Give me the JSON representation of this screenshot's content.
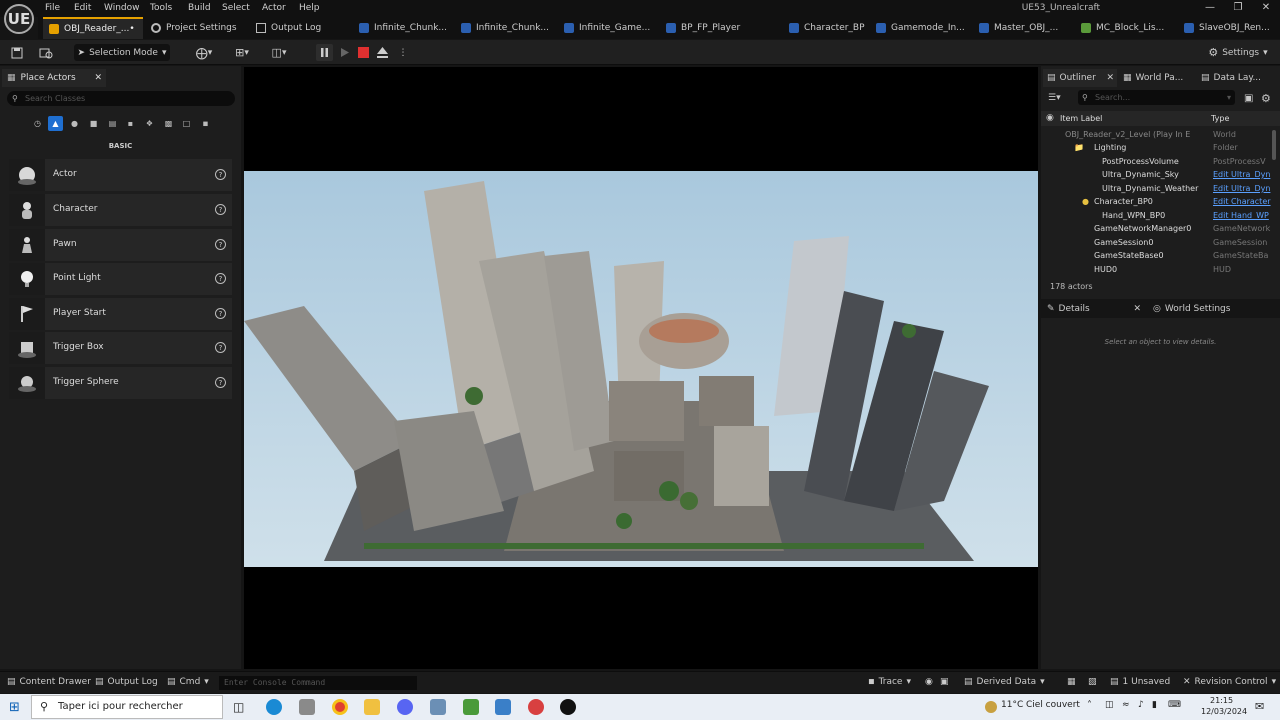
{
  "menu": {
    "items": [
      "File",
      "Edit",
      "Window",
      "Tools",
      "Build",
      "Select",
      "Actor",
      "Help"
    ],
    "logo": "UE",
    "window_title": "UE53_Unrealcraft"
  },
  "tabs": [
    {
      "label": "OBJ_Reader_...•",
      "icon": "level-icon"
    },
    {
      "label": "Project Settings",
      "icon": "settings-icon"
    },
    {
      "label": "Output Log",
      "icon": "document-icon"
    },
    {
      "label": "Infinite_Chunk...",
      "icon": "blueprint-icon"
    },
    {
      "label": "Infinite_Chunk...",
      "icon": "blueprint-icon"
    },
    {
      "label": "Infinite_Game...",
      "icon": "blueprint-icon"
    },
    {
      "label": "BP_FP_Player",
      "icon": "blueprint-icon"
    },
    {
      "label": "Character_BP",
      "icon": "blueprint-icon"
    },
    {
      "label": "Gamemode_In...",
      "icon": "blueprint-icon"
    },
    {
      "label": "Master_OBJ_...",
      "icon": "blueprint-icon"
    },
    {
      "label": "MC_Block_Lis...",
      "icon": "datatable-icon"
    },
    {
      "label": "SlaveOBJ_Ren...",
      "icon": "blueprint-icon"
    }
  ],
  "toolbar": {
    "selection_mode": "Selection Mode",
    "settings": "Settings"
  },
  "place_actors": {
    "tab_label": "Place Actors",
    "search_placeholder": "Search Classes",
    "category_label": "BASIC",
    "items": [
      "Actor",
      "Character",
      "Pawn",
      "Point Light",
      "Player Start",
      "Trigger Box",
      "Trigger Sphere"
    ]
  },
  "right_tabs": {
    "outliner": "Outliner",
    "world_partition": "World Pa...",
    "data_layers": "Data Lay...",
    "search_placeholder": "Search...",
    "col_label": "Item Label",
    "col_type": "Type"
  },
  "outliner_rows": [
    {
      "label": "OBJ_Reader_v2_Level (Play In E",
      "type": "World",
      "link": false
    },
    {
      "label": "Lighting",
      "type": "Folder",
      "link": false
    },
    {
      "label": "PostProcessVolume",
      "type": "PostProcessV",
      "link": false
    },
    {
      "label": "Ultra_Dynamic_Sky",
      "type": "Edit Ultra_Dyn",
      "link": true
    },
    {
      "label": "Ultra_Dynamic_Weather",
      "type": "Edit Ultra_Dyn",
      "link": true
    },
    {
      "label": "Character_BP0",
      "type": "Edit Character",
      "link": true
    },
    {
      "label": "Hand_WPN_BP0",
      "type": "Edit Hand_WP",
      "link": true
    },
    {
      "label": "GameNetworkManager0",
      "type": "GameNetwork",
      "link": false
    },
    {
      "label": "GameSession0",
      "type": "GameSession",
      "link": false
    },
    {
      "label": "GameStateBase0",
      "type": "GameStateBa",
      "link": false
    },
    {
      "label": "HUD0",
      "type": "HUD",
      "link": false
    }
  ],
  "actor_count": "178 actors",
  "details": {
    "tab_label": "Details",
    "world_settings": "World Settings",
    "empty_text": "Select an object to view details."
  },
  "statusbar": {
    "content_drawer": "Content Drawer",
    "output_log": "Output Log",
    "cmd": "Cmd",
    "console_placeholder": "Enter Console Command",
    "trace": "Trace",
    "derived_data": "Derived Data",
    "unsaved": "1 Unsaved",
    "revision_control": "Revision Control"
  },
  "taskbar": {
    "search_placeholder": "Taper ici pour rechercher",
    "weather_temp": "11°C",
    "weather_text": "Ciel couvert",
    "time": "21:15",
    "date": "12/03/2024"
  },
  "colors": {
    "accent_orange": "#e6a100",
    "link_blue": "#5aa0ff",
    "stop_red": "#e03030",
    "filter_active": "#1f6fd1"
  }
}
